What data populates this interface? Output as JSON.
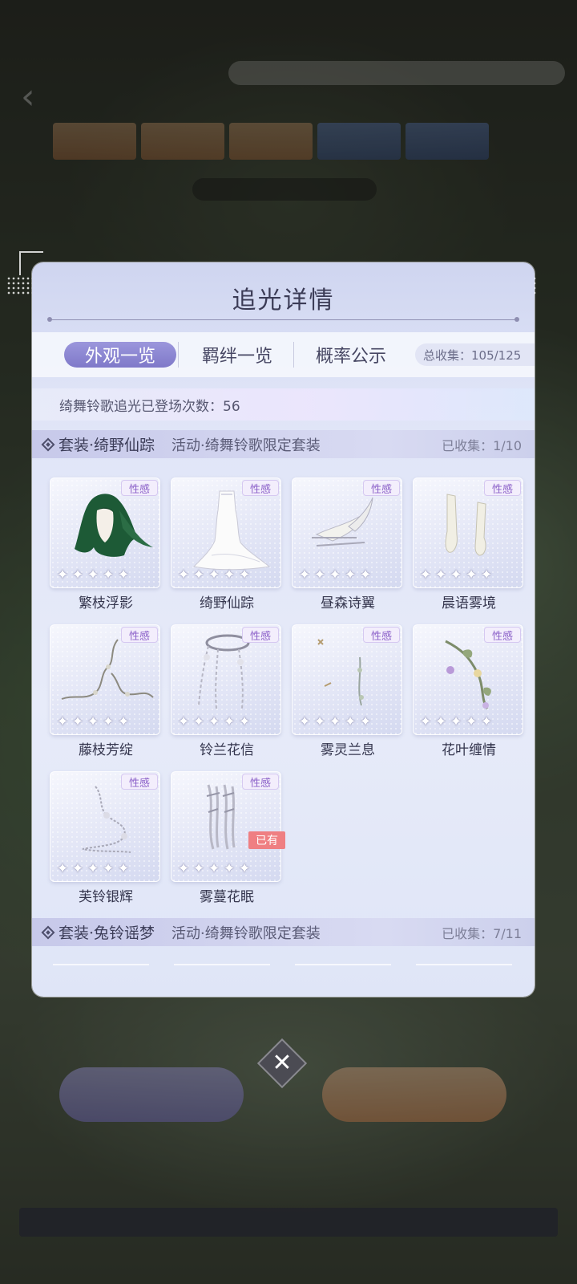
{
  "title": "追光详情",
  "tabs": [
    {
      "label": "外观一览",
      "active": true
    },
    {
      "label": "羁绊一览",
      "active": false
    },
    {
      "label": "概率公示",
      "active": false
    }
  ],
  "total_collected": "总收集：105/125",
  "appear_count": "绮舞铃歌追光已登场次数：56",
  "sets": [
    {
      "name": "套装·绮野仙踪",
      "event": "活动·绮舞铃歌限定套装",
      "collected": "已收集：1/10",
      "items": [
        {
          "name": "繁枝浮影",
          "tag": "性感",
          "owned": ""
        },
        {
          "name": "绮野仙踪",
          "tag": "性感",
          "owned": ""
        },
        {
          "name": "昼森诗翼",
          "tag": "性感",
          "owned": ""
        },
        {
          "name": "晨语雾境",
          "tag": "性感",
          "owned": ""
        },
        {
          "name": "藤枝芳绽",
          "tag": "性感",
          "owned": ""
        },
        {
          "name": "铃兰花信",
          "tag": "性感",
          "owned": ""
        },
        {
          "name": "雾灵兰息",
          "tag": "性感",
          "owned": ""
        },
        {
          "name": "花叶缠情",
          "tag": "性感",
          "owned": ""
        },
        {
          "name": "芙铃银辉",
          "tag": "性感",
          "owned": ""
        },
        {
          "name": "雾蔓花眠",
          "tag": "性感",
          "owned": "已有"
        }
      ]
    },
    {
      "name": "套装·兔铃谣梦",
      "event": "活动·绮舞铃歌限定套装",
      "collected": "已收集：7/11"
    }
  ],
  "colors": {
    "tab_active": "#8a84d3",
    "tag_text": "#8a5fc8",
    "owned_badge": "#ef7f82"
  },
  "icons": {
    "close": "close-icon",
    "set_marker": "diamond-icon",
    "rarity": "star-icon"
  }
}
